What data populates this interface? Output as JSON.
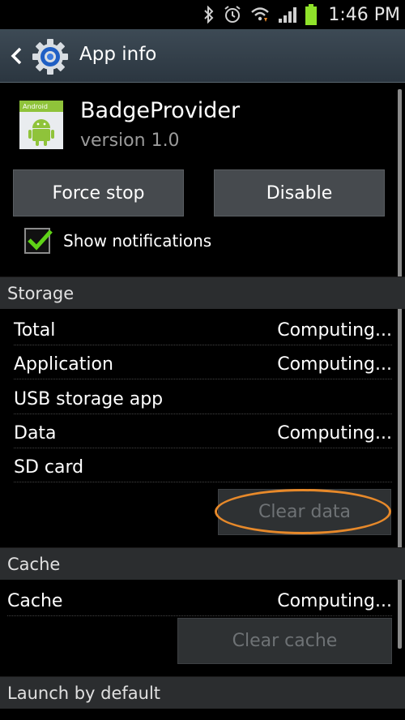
{
  "status_bar": {
    "time": "1:46 PM",
    "icons": [
      "bluetooth-icon",
      "alarm-icon",
      "wifi-icon",
      "signal-icon",
      "battery-icon"
    ]
  },
  "action_bar": {
    "title": "App info",
    "back_icon": "chevron-left-icon",
    "app_icon": "settings-gear-icon"
  },
  "app": {
    "name": "BadgeProvider",
    "version": "version 1.0",
    "icon_label": "Android",
    "icon": "android-robot-icon"
  },
  "buttons": {
    "force_stop": "Force stop",
    "disable": "Disable"
  },
  "notifications": {
    "label": "Show notifications",
    "checked": true
  },
  "storage": {
    "header": "Storage",
    "rows": [
      {
        "label": "Total",
        "value": "Computing..."
      },
      {
        "label": "Application",
        "value": "Computing..."
      },
      {
        "label": "USB storage app",
        "value": ""
      },
      {
        "label": "Data",
        "value": "Computing..."
      },
      {
        "label": "SD card",
        "value": ""
      }
    ],
    "clear_button": "Clear data"
  },
  "cache": {
    "header": "Cache",
    "row": {
      "label": "Cache",
      "value": "Computing..."
    },
    "clear_button": "Clear cache"
  },
  "launch": {
    "header": "Launch by default"
  },
  "colors": {
    "highlight": "#e7892a",
    "checkmark": "#5fd317",
    "action_bar": "#35414b"
  }
}
